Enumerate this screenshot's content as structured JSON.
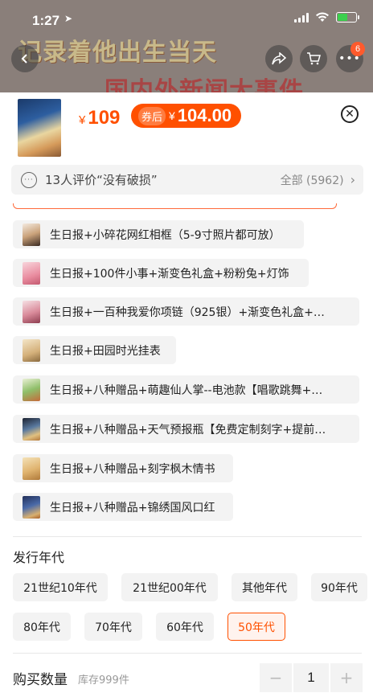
{
  "status_bar": {
    "time": "1:27",
    "badge_count": "6"
  },
  "banner": {
    "line1": "记录着他出生当天",
    "line2": "国内外新闻大事件"
  },
  "product": {
    "currency": "¥",
    "price": "109",
    "coupon_label": "券后",
    "coupon_price": "104.00"
  },
  "review": {
    "text": "13人评价“没有破损”",
    "all_label": "全部 (5962)"
  },
  "options": [
    {
      "label": "生日报+小碎花网红相框（5-9寸照片都可放）"
    },
    {
      "label": "生日报+100件小事+渐变色礼盒+粉粉兔+灯饰"
    },
    {
      "label": "生日报+一百种我爱你项链（925银）+渐变色礼盒+…"
    },
    {
      "label": "生日报+田园时光挂表"
    },
    {
      "label": "生日报+八种赠品+萌趣仙人掌--电池款【唱歌跳舞+…"
    },
    {
      "label": "生日报+八种赠品+天气预报瓶【免费定制刻字+提前…"
    },
    {
      "label": "生日报+八种赠品+刻字枫木情书"
    },
    {
      "label": "生日报+八种赠品+锦绣国风口红"
    }
  ],
  "era": {
    "title": "发行年代",
    "options": [
      {
        "label": "21世纪10年代"
      },
      {
        "label": "21世纪00年代"
      },
      {
        "label": "其他年代"
      },
      {
        "label": "90年代"
      },
      {
        "label": "80年代"
      },
      {
        "label": "70年代"
      },
      {
        "label": "60年代"
      },
      {
        "label": "50年代"
      }
    ],
    "selected": "50年代"
  },
  "quantity": {
    "label": "购买数量",
    "stock": "库存999件",
    "value": "1",
    "minus": "−",
    "plus": "+"
  },
  "colors": {
    "accent": "#ff5000"
  }
}
